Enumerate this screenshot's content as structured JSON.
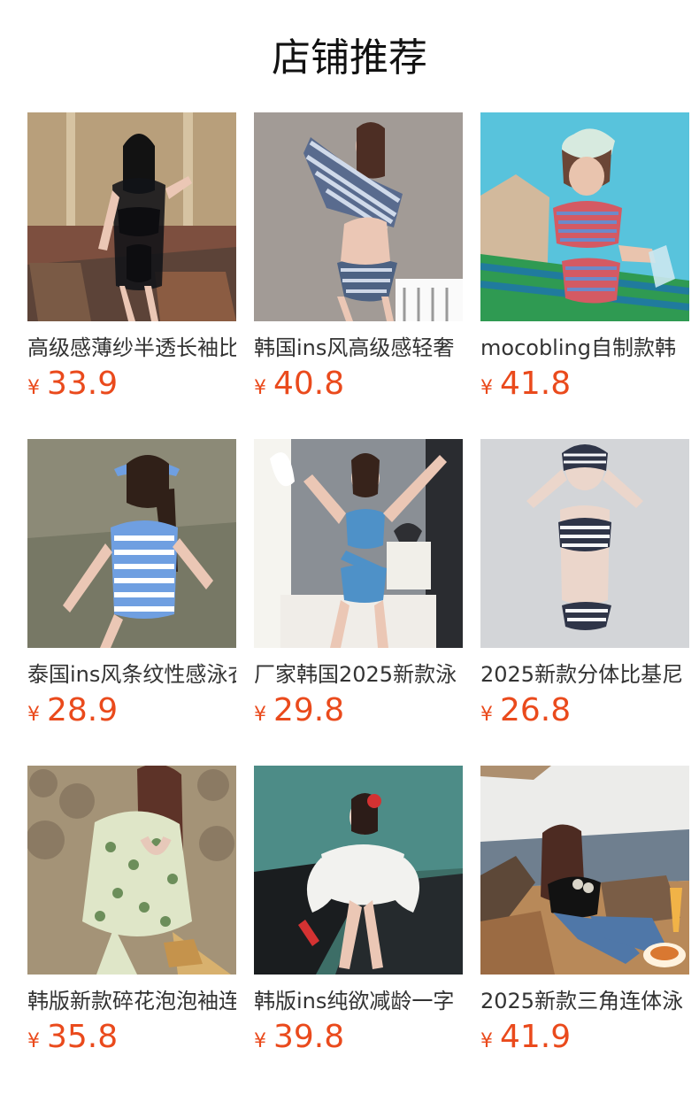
{
  "section": {
    "title": "店铺推荐"
  },
  "products": [
    {
      "name": "高级感薄纱半透长袖比基尼",
      "currency": "¥",
      "price": "33.9",
      "image": {
        "bg": "#b89f7b",
        "accent": "#111318",
        "secondary": "#d6c3a2",
        "scene": "pool-pavilion"
      }
    },
    {
      "name": "韩国ins风高级感轻奢",
      "currency": "¥",
      "price": "40.8",
      "image": {
        "bg": "#8f8985",
        "accent": "#596b8e",
        "secondary": "#ffffff",
        "scene": "studio-stripes"
      }
    },
    {
      "name": "mocobling自制款韩",
      "currency": "¥",
      "price": "41.8",
      "image": {
        "bg": "#52c5dd",
        "accent": "#d45a63",
        "secondary": "#2f9a52",
        "scene": "poolside-stripes"
      }
    },
    {
      "name": "泰国ins风条纹性感泳衣",
      "currency": "¥",
      "price": "28.9",
      "image": {
        "bg": "#8c8a77",
        "accent": "#6f9fe1",
        "secondary": "#ffffff",
        "scene": "beach-stripes"
      }
    },
    {
      "name": "厂家韩国2025新款泳",
      "currency": "¥",
      "price": "29.8",
      "image": {
        "bg": "#8a8f95",
        "accent": "#4e91c8",
        "secondary": "#f5f4ef",
        "scene": "window-blue"
      }
    },
    {
      "name": "2025新款分体比基尼",
      "currency": "¥",
      "price": "26.8",
      "image": {
        "bg": "#d3d5d8",
        "accent": "#2f3548",
        "secondary": "#f7f8fa",
        "scene": "studio-navy"
      }
    },
    {
      "name": "韩版新款碎花泡泡袖连衣",
      "currency": "¥",
      "price": "35.8",
      "image": {
        "bg": "#a49377",
        "accent": "#dfe6c8",
        "secondary": "#6c8e5a",
        "scene": "rock-floral"
      }
    },
    {
      "name": "韩版ins纯欲减龄一字",
      "currency": "¥",
      "price": "39.8",
      "image": {
        "bg": "#3d6e67",
        "accent": "#f2f2ef",
        "secondary": "#1a1d1f",
        "scene": "sea-white"
      }
    },
    {
      "name": "2025新款三角连体泳",
      "currency": "¥",
      "price": "41.9",
      "image": {
        "bg": "#d8d3c9",
        "accent": "#121212",
        "secondary": "#4f77a8",
        "scene": "beach-chair"
      }
    }
  ]
}
